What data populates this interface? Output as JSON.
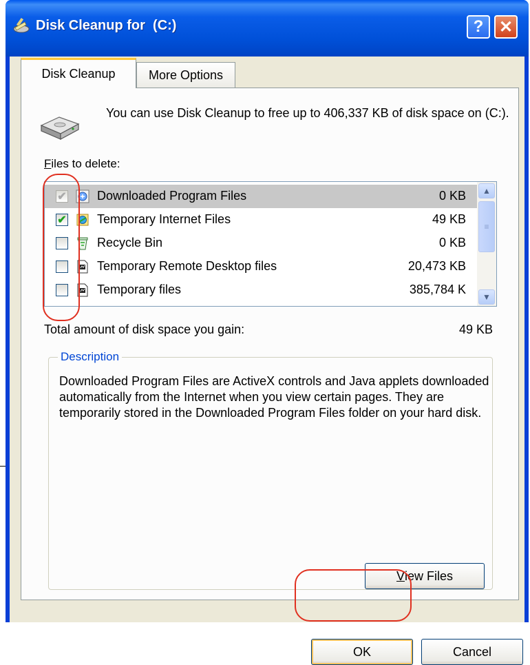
{
  "window": {
    "title": "Disk Cleanup for  (C:)",
    "help_label": "?",
    "close_label": "✕"
  },
  "tabs": [
    {
      "label": "Disk Cleanup",
      "active": true
    },
    {
      "label": "More Options",
      "active": false
    }
  ],
  "intro": "You can use Disk Cleanup to free up to 406,337 KB of disk space on  (C:).",
  "files_label": {
    "underlined": "F",
    "rest": "iles to delete:"
  },
  "files": [
    {
      "name": "Downloaded Program Files",
      "size": "0 KB",
      "checked": true,
      "disabled": true,
      "selected": true,
      "icon": "activex-icon"
    },
    {
      "name": "Temporary Internet Files",
      "size": "49 KB",
      "checked": true,
      "disabled": false,
      "selected": false,
      "icon": "internet-files-icon"
    },
    {
      "name": "Recycle Bin",
      "size": "0 KB",
      "checked": false,
      "disabled": false,
      "selected": false,
      "icon": "recycle-bin-icon"
    },
    {
      "name": "Temporary Remote Desktop files",
      "size": "20,473 KB",
      "checked": false,
      "disabled": false,
      "selected": false,
      "icon": "file-icon"
    },
    {
      "name": "Temporary files",
      "size": "385,784 K",
      "checked": false,
      "disabled": false,
      "selected": false,
      "icon": "file-icon"
    }
  ],
  "total": {
    "label": "Total amount of disk space you gain:",
    "value": "49 KB"
  },
  "description": {
    "legend": "Description",
    "text": "Downloaded Program Files are ActiveX controls and Java applets downloaded automatically from the Internet when you view certain pages. They are temporarily stored in the Downloaded Program Files folder on your hard disk."
  },
  "buttons": {
    "view_files": {
      "underlined": "V",
      "rest": "iew Files"
    },
    "ok": "OK",
    "cancel": "Cancel"
  },
  "colors": {
    "titlebar": "#0050d8",
    "accent_annotation": "#e03020",
    "description_legend": "#0046d5"
  }
}
